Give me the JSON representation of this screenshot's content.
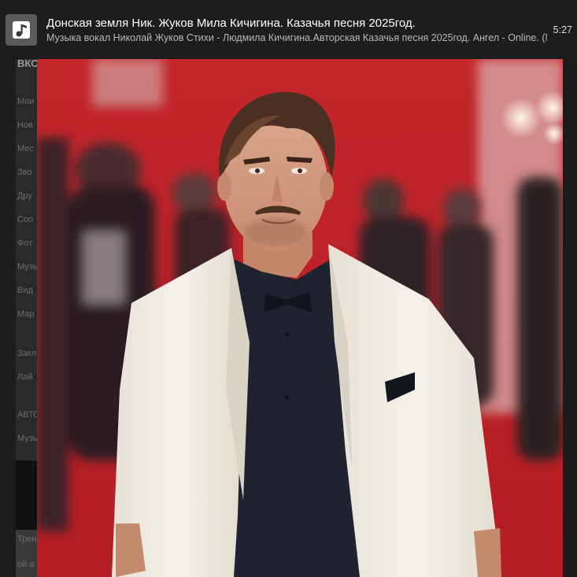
{
  "header": {
    "icon": "music-note-icon",
    "title": "Донская земля Ник. Жуков Мила Кичигина. Казачья песня 2025год.",
    "subtitle": "Музыка вокал Николай Жуков Стихи - Людмила Кичигина.Авторская Казачья песня 2025год. Ангел - Online. (Музы",
    "duration": "5:27"
  },
  "background_page": {
    "labels": [
      "ВКС",
      "Мои",
      "Нов",
      "Мес",
      "Зво",
      "Дру",
      "Соо",
      "Фот",
      "Музы",
      "Вид",
      "Мар",
      "Закл",
      "Лай",
      "АВТО",
      "Музы",
      "Трен",
      "ой а",
      "ВК"
    ]
  },
  "colors": {
    "header_bg": "#1d1d1d",
    "carpet_red": "#c0282c",
    "jacket_white": "#f1ece2",
    "shirt_dark": "#1f2330"
  }
}
